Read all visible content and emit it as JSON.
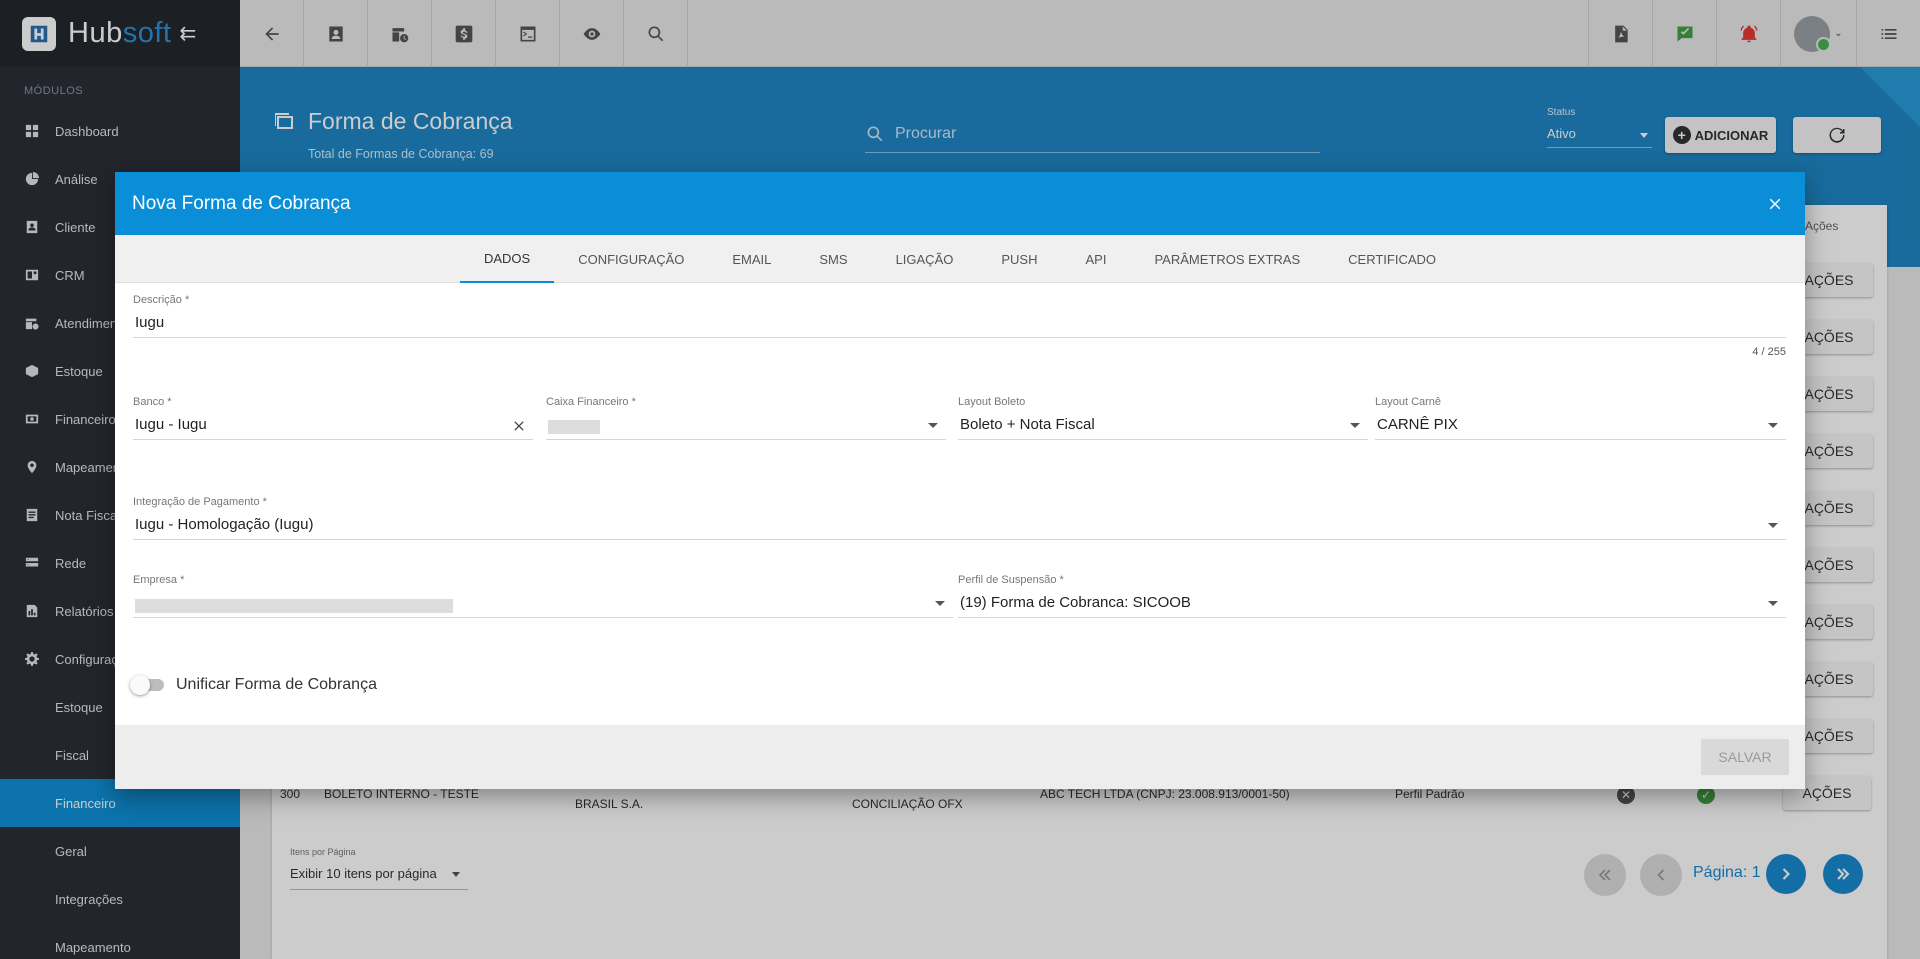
{
  "brand": {
    "name_prefix": "Hub",
    "name_suffix": "soft"
  },
  "sidebar": {
    "modules_title": "MÓDULOS",
    "items": [
      {
        "label": "Dashboard",
        "icon": "dashboard-icon"
      },
      {
        "label": "Análise",
        "icon": "pie-chart-icon"
      },
      {
        "label": "Cliente",
        "icon": "contact-card-icon"
      },
      {
        "label": "CRM",
        "icon": "crm-icon"
      },
      {
        "label": "Atendimento",
        "icon": "calendar-clock-icon"
      },
      {
        "label": "Estoque",
        "icon": "box-icon"
      },
      {
        "label": "Financeiro",
        "icon": "money-icon"
      },
      {
        "label": "Mapeamento",
        "icon": "map-pin-icon"
      },
      {
        "label": "Nota Fiscal",
        "icon": "invoice-icon"
      },
      {
        "label": "Rede",
        "icon": "network-icon"
      },
      {
        "label": "Relatórios",
        "icon": "report-icon"
      },
      {
        "label": "Configurações",
        "icon": "gear-icon"
      }
    ],
    "sub_items": [
      "Estoque",
      "Fiscal",
      "Financeiro",
      "Geral",
      "Integrações",
      "Mapeamento"
    ],
    "active_sub": "Financeiro"
  },
  "page": {
    "title": "Forma de Cobrança",
    "subtitle": "Total de Formas de Cobrança: 69",
    "search_placeholder": "Procurar",
    "status_label": "Status",
    "status_value": "Ativo",
    "add_label": "ADICIONAR"
  },
  "table": {
    "actions_header": "Ações",
    "actions_label": "AÇÕES",
    "row": {
      "code": "300",
      "description": "BOLETO INTERNO - TESTE",
      "bank": "BRASIL S.A.",
      "cash": "CONCILIAÇÃO OFX",
      "company": "ABC TECH LTDA (CNPJ: 23.008.913/0001-50)",
      "profile": "Perfil Padrão"
    }
  },
  "pager": {
    "per_page_label": "Itens por Página",
    "per_page_value": "Exibir 10 itens por página",
    "page_text": "Página: 1"
  },
  "dialog": {
    "title": "Nova Forma de Cobrança",
    "tabs": [
      "DADOS",
      "CONFIGURAÇÃO",
      "EMAIL",
      "SMS",
      "LIGAÇÃO",
      "PUSH",
      "API",
      "PARÂMETROS EXTRAS",
      "CERTIFICADO"
    ],
    "active_tab": "DADOS",
    "descricao_label": "Descrição *",
    "descricao_value": "Iugu",
    "descricao_counter": "4 / 255",
    "banco_label": "Banco *",
    "banco_value": "Iugu - Iugu",
    "caixa_label": "Caixa Financeiro *",
    "layout_boleto_label": "Layout Boleto",
    "layout_boleto_value": "Boleto + Nota Fiscal",
    "layout_carne_label": "Layout Carnê",
    "layout_carne_value": "CARNÊ PIX",
    "integracao_label": "Integração de Pagamento *",
    "integracao_value": "Iugu - Homologação (Iugu)",
    "empresa_label": "Empresa *",
    "perfil_label": "Perfil de Suspensão *",
    "perfil_value": "(19) Forma de Cobranca: SICOOB",
    "toggle_label": "Unificar Forma de Cobrança",
    "save_label": "SALVAR"
  },
  "colors": {
    "primary": "#0b8ed8",
    "sidebar": "#2b3038",
    "active": "#0f90d8",
    "success": "#43a047",
    "danger": "#e53935"
  }
}
